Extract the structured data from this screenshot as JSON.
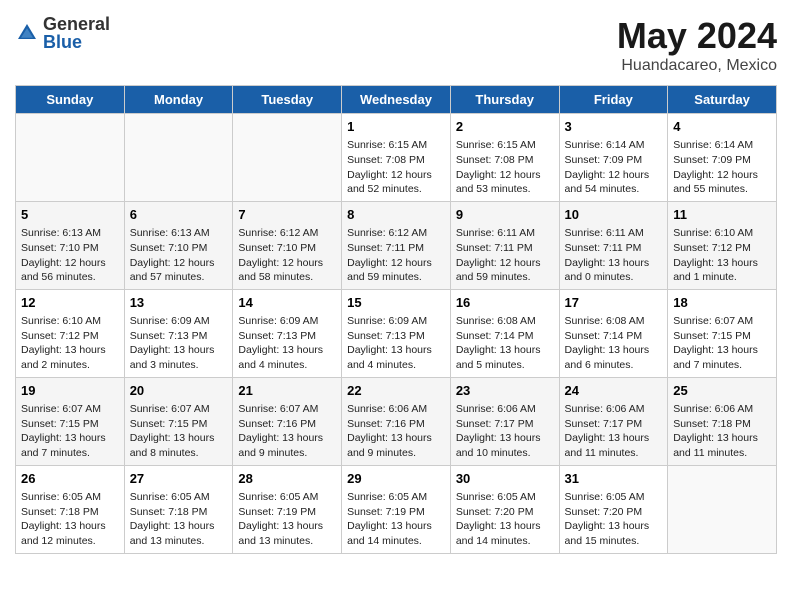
{
  "header": {
    "logo_general": "General",
    "logo_blue": "Blue",
    "month": "May 2024",
    "location": "Huandacareo, Mexico"
  },
  "weekdays": [
    "Sunday",
    "Monday",
    "Tuesday",
    "Wednesday",
    "Thursday",
    "Friday",
    "Saturday"
  ],
  "weeks": [
    [
      {
        "day": "",
        "info": ""
      },
      {
        "day": "",
        "info": ""
      },
      {
        "day": "",
        "info": ""
      },
      {
        "day": "1",
        "info": "Sunrise: 6:15 AM\nSunset: 7:08 PM\nDaylight: 12 hours\nand 52 minutes."
      },
      {
        "day": "2",
        "info": "Sunrise: 6:15 AM\nSunset: 7:08 PM\nDaylight: 12 hours\nand 53 minutes."
      },
      {
        "day": "3",
        "info": "Sunrise: 6:14 AM\nSunset: 7:09 PM\nDaylight: 12 hours\nand 54 minutes."
      },
      {
        "day": "4",
        "info": "Sunrise: 6:14 AM\nSunset: 7:09 PM\nDaylight: 12 hours\nand 55 minutes."
      }
    ],
    [
      {
        "day": "5",
        "info": "Sunrise: 6:13 AM\nSunset: 7:10 PM\nDaylight: 12 hours\nand 56 minutes."
      },
      {
        "day": "6",
        "info": "Sunrise: 6:13 AM\nSunset: 7:10 PM\nDaylight: 12 hours\nand 57 minutes."
      },
      {
        "day": "7",
        "info": "Sunrise: 6:12 AM\nSunset: 7:10 PM\nDaylight: 12 hours\nand 58 minutes."
      },
      {
        "day": "8",
        "info": "Sunrise: 6:12 AM\nSunset: 7:11 PM\nDaylight: 12 hours\nand 59 minutes."
      },
      {
        "day": "9",
        "info": "Sunrise: 6:11 AM\nSunset: 7:11 PM\nDaylight: 12 hours\nand 59 minutes."
      },
      {
        "day": "10",
        "info": "Sunrise: 6:11 AM\nSunset: 7:11 PM\nDaylight: 13 hours\nand 0 minutes."
      },
      {
        "day": "11",
        "info": "Sunrise: 6:10 AM\nSunset: 7:12 PM\nDaylight: 13 hours\nand 1 minute."
      }
    ],
    [
      {
        "day": "12",
        "info": "Sunrise: 6:10 AM\nSunset: 7:12 PM\nDaylight: 13 hours\nand 2 minutes."
      },
      {
        "day": "13",
        "info": "Sunrise: 6:09 AM\nSunset: 7:13 PM\nDaylight: 13 hours\nand 3 minutes."
      },
      {
        "day": "14",
        "info": "Sunrise: 6:09 AM\nSunset: 7:13 PM\nDaylight: 13 hours\nand 4 minutes."
      },
      {
        "day": "15",
        "info": "Sunrise: 6:09 AM\nSunset: 7:13 PM\nDaylight: 13 hours\nand 4 minutes."
      },
      {
        "day": "16",
        "info": "Sunrise: 6:08 AM\nSunset: 7:14 PM\nDaylight: 13 hours\nand 5 minutes."
      },
      {
        "day": "17",
        "info": "Sunrise: 6:08 AM\nSunset: 7:14 PM\nDaylight: 13 hours\nand 6 minutes."
      },
      {
        "day": "18",
        "info": "Sunrise: 6:07 AM\nSunset: 7:15 PM\nDaylight: 13 hours\nand 7 minutes."
      }
    ],
    [
      {
        "day": "19",
        "info": "Sunrise: 6:07 AM\nSunset: 7:15 PM\nDaylight: 13 hours\nand 7 minutes."
      },
      {
        "day": "20",
        "info": "Sunrise: 6:07 AM\nSunset: 7:15 PM\nDaylight: 13 hours\nand 8 minutes."
      },
      {
        "day": "21",
        "info": "Sunrise: 6:07 AM\nSunset: 7:16 PM\nDaylight: 13 hours\nand 9 minutes."
      },
      {
        "day": "22",
        "info": "Sunrise: 6:06 AM\nSunset: 7:16 PM\nDaylight: 13 hours\nand 9 minutes."
      },
      {
        "day": "23",
        "info": "Sunrise: 6:06 AM\nSunset: 7:17 PM\nDaylight: 13 hours\nand 10 minutes."
      },
      {
        "day": "24",
        "info": "Sunrise: 6:06 AM\nSunset: 7:17 PM\nDaylight: 13 hours\nand 11 minutes."
      },
      {
        "day": "25",
        "info": "Sunrise: 6:06 AM\nSunset: 7:18 PM\nDaylight: 13 hours\nand 11 minutes."
      }
    ],
    [
      {
        "day": "26",
        "info": "Sunrise: 6:05 AM\nSunset: 7:18 PM\nDaylight: 13 hours\nand 12 minutes."
      },
      {
        "day": "27",
        "info": "Sunrise: 6:05 AM\nSunset: 7:18 PM\nDaylight: 13 hours\nand 13 minutes."
      },
      {
        "day": "28",
        "info": "Sunrise: 6:05 AM\nSunset: 7:19 PM\nDaylight: 13 hours\nand 13 minutes."
      },
      {
        "day": "29",
        "info": "Sunrise: 6:05 AM\nSunset: 7:19 PM\nDaylight: 13 hours\nand 14 minutes."
      },
      {
        "day": "30",
        "info": "Sunrise: 6:05 AM\nSunset: 7:20 PM\nDaylight: 13 hours\nand 14 minutes."
      },
      {
        "day": "31",
        "info": "Sunrise: 6:05 AM\nSunset: 7:20 PM\nDaylight: 13 hours\nand 15 minutes."
      },
      {
        "day": "",
        "info": ""
      }
    ]
  ]
}
